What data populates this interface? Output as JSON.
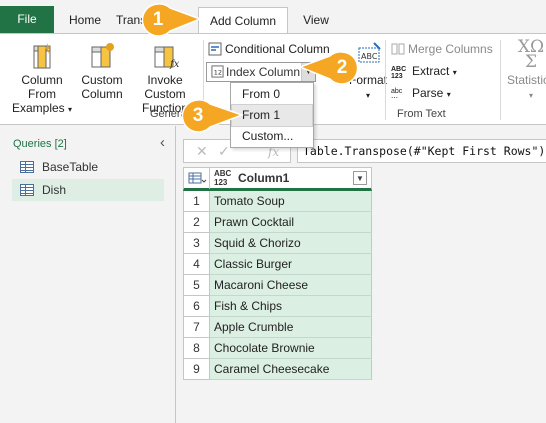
{
  "tabs": {
    "file": "File",
    "home": "Home",
    "transform": "Transform",
    "add_column": "Add Column",
    "view": "View"
  },
  "ribbon": {
    "column_from_examples": [
      "Column From",
      "Examples"
    ],
    "custom_column": [
      "Custom",
      "Column"
    ],
    "invoke_custom_function": [
      "Invoke Custom",
      "Function"
    ],
    "general_group": "General",
    "conditional_column": "Conditional Column",
    "index_column": "Index Column",
    "format_label": "Format",
    "merge_columns": "Merge Columns",
    "extract": "Extract",
    "parse": "Parse",
    "from_text_group": "From Text",
    "statistics": "Statistics"
  },
  "index_menu": {
    "items": [
      "From 0",
      "From 1",
      "Custom..."
    ],
    "highlighted": "From 1"
  },
  "callouts": [
    "1",
    "2",
    "3"
  ],
  "queries": {
    "title": "Queries [2]",
    "items": [
      {
        "name": "BaseTable",
        "selected": false
      },
      {
        "name": "Dish",
        "selected": true
      }
    ]
  },
  "formula": {
    "text": "Table.Transpose(#\"Kept First Rows\")"
  },
  "grid": {
    "type_label_top": "ABC",
    "type_label_bottom": "123",
    "column_name": "Column1",
    "rows": [
      {
        "n": "1",
        "value": "Tomato Soup"
      },
      {
        "n": "2",
        "value": "Prawn Cocktail"
      },
      {
        "n": "3",
        "value": "Squid & Chorizo"
      },
      {
        "n": "4",
        "value": "Classic Burger"
      },
      {
        "n": "5",
        "value": "Macaroni Cheese"
      },
      {
        "n": "6",
        "value": "Fish & Chips"
      },
      {
        "n": "7",
        "value": "Apple Crumble"
      },
      {
        "n": "8",
        "value": "Chocolate Brownie"
      },
      {
        "n": "9",
        "value": "Caramel Cheesecake"
      }
    ]
  },
  "colors": {
    "accent": "#217346",
    "callout": "#f5a623",
    "selected_row": "#dcefe3"
  }
}
